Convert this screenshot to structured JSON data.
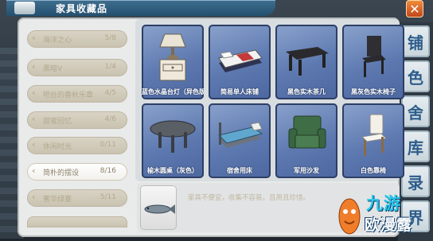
{
  "window": {
    "title": "家具收藏品"
  },
  "sidebar": {
    "items": [
      {
        "label": "海洋之心",
        "count": "5/8"
      },
      {
        "label": "黑暗V",
        "count": "1/4"
      },
      {
        "label": "吧台的春秋乐章",
        "count": "4/5"
      },
      {
        "label": "甜蜜回忆",
        "count": "4/6"
      },
      {
        "label": "休闲时光",
        "count": "0/11"
      },
      {
        "label": "简朴的摆设",
        "count": "8/16"
      },
      {
        "label": "奢华绿宴",
        "count": "5/11"
      }
    ]
  },
  "grid": {
    "items": [
      {
        "name": "蓝色水晶台灯（异色版）",
        "icon": "crystal-lamp-icon"
      },
      {
        "name": "简易单人床铺",
        "icon": "single-bed-icon"
      },
      {
        "name": "黑色实木茶几",
        "icon": "black-coffee-table-icon"
      },
      {
        "name": "黑灰色实木椅子",
        "icon": "dark-chair-icon"
      },
      {
        "name": "榆木圆桌（灰色）",
        "icon": "round-table-icon"
      },
      {
        "name": "宿舍用床",
        "icon": "dorm-bed-icon"
      },
      {
        "name": "军用沙发",
        "icon": "army-sofa-icon"
      },
      {
        "name": "白色靠椅",
        "icon": "white-chair-icon"
      }
    ]
  },
  "detail": {
    "description": "家具不便宜，收集不容易，且用且珍惜。",
    "icon": "fish-item-icon"
  },
  "right_tabs": [
    "铺",
    "色",
    "舍",
    "库",
    "录",
    "界"
  ],
  "watermark": {
    "line1": "九游",
    "line2": "欧漫露"
  }
}
